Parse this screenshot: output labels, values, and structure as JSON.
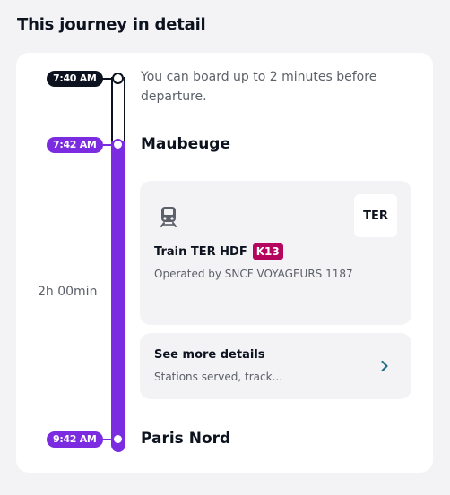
{
  "heading": "This journey in detail",
  "timeline": {
    "boarding_time": "7:40 AM",
    "boarding_note": "You can board up to 2 minutes before departure.",
    "departure_time": "7:42 AM",
    "departure_station": "Maubeuge",
    "duration": "2h 00min",
    "arrival_time": "9:42 AM",
    "arrival_station": "Paris Nord"
  },
  "segment": {
    "icon": "train-icon",
    "brand_badge": "TER",
    "train_name": "Train TER HDF",
    "line_code": "K13",
    "operator": "Operated by SNCF VOYAGEURS 1187"
  },
  "details": {
    "title": "See more details",
    "subtitle": "Stations served, track...",
    "icon": "chevron-right-icon"
  },
  "colors": {
    "accent": "#7c2ce0",
    "dark": "#0c131f",
    "line_badge": "#b5055e",
    "link_chevron": "#1f6f8b"
  }
}
